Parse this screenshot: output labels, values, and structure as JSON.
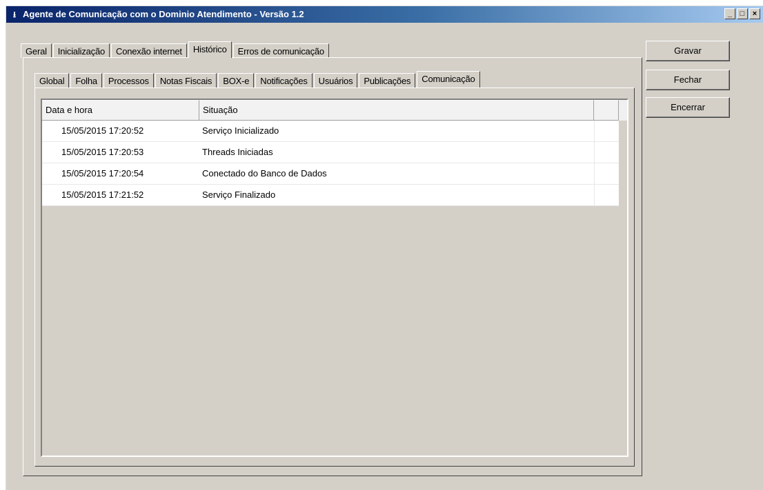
{
  "window": {
    "title": "Agente de Comunicação com o Dominio Atendimento - Versão 1.2",
    "app_icon": "download-arrow-icon",
    "controls": {
      "minimize": "_",
      "maximize": "□",
      "close": "×"
    }
  },
  "outer_tabs": [
    {
      "label": "Geral"
    },
    {
      "label": "Inicialização"
    },
    {
      "label": "Conexão internet"
    },
    {
      "label": "Histórico",
      "active": true
    },
    {
      "label": "Erros de comunicação"
    }
  ],
  "inner_tabs": [
    {
      "label": "Global"
    },
    {
      "label": "Folha"
    },
    {
      "label": "Processos"
    },
    {
      "label": "Notas Fiscais"
    },
    {
      "label": "BOX-e"
    },
    {
      "label": "Notificações"
    },
    {
      "label": "Usuários"
    },
    {
      "label": "Publicações"
    },
    {
      "label": "Comunicação",
      "active": true
    }
  ],
  "list": {
    "columns": [
      "Data e hora",
      "Situação",
      ""
    ],
    "rows": [
      {
        "datetime": "15/05/2015 17:20:52",
        "status": "Serviço Inicializado"
      },
      {
        "datetime": "15/05/2015 17:20:53",
        "status": "Threads Iniciadas"
      },
      {
        "datetime": "15/05/2015 17:20:54",
        "status": "Conectado do Banco de Dados"
      },
      {
        "datetime": "15/05/2015 17:21:52",
        "status": "Serviço Finalizado"
      }
    ]
  },
  "buttons": {
    "save": "Gravar",
    "close": "Fechar",
    "shutdown": "Encerrar"
  }
}
